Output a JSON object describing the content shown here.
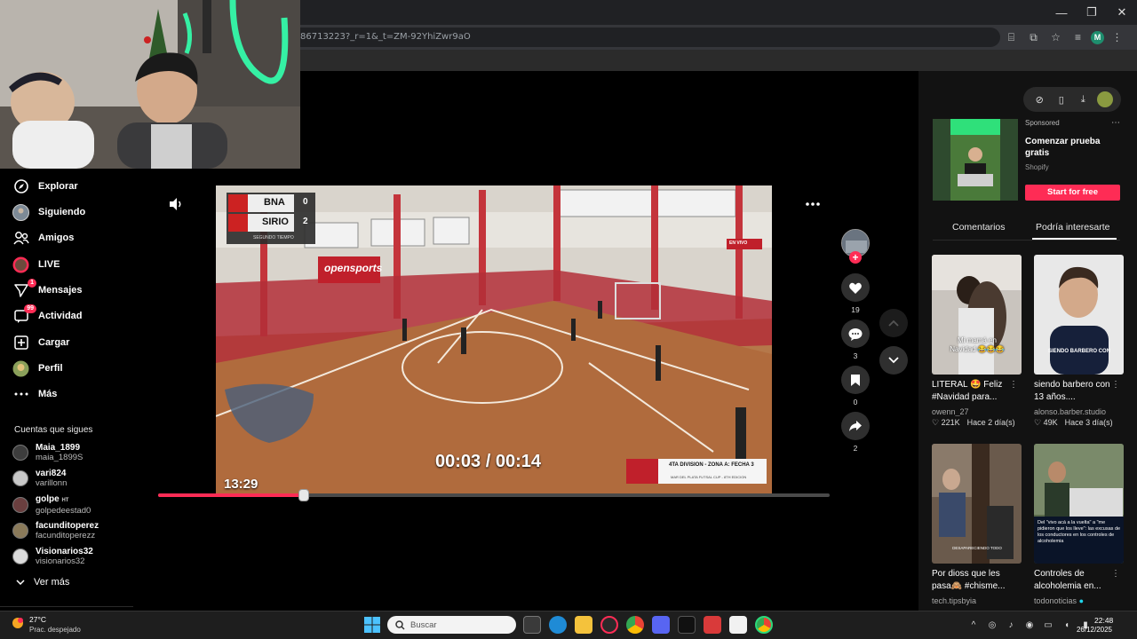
{
  "browser": {
    "url_fragment": "86713223?_r=1&_t=ZM-92YhiZwr9aO",
    "window_controls": [
      "—",
      "❐",
      "✕"
    ],
    "profile_initial": "M"
  },
  "sidebar": {
    "items": [
      {
        "label": "Explorar",
        "icon": "compass-icon"
      },
      {
        "label": "Siguiendo",
        "icon": "following-avatar-icon"
      },
      {
        "label": "Amigos",
        "icon": "friends-icon"
      },
      {
        "label": "LIVE",
        "icon": "live-icon"
      },
      {
        "label": "Mensajes",
        "icon": "messages-icon",
        "badge": "1"
      },
      {
        "label": "Actividad",
        "icon": "activity-icon",
        "badge": "99"
      },
      {
        "label": "Cargar",
        "icon": "upload-icon"
      },
      {
        "label": "Perfil",
        "icon": "profile-icon"
      },
      {
        "label": "Más",
        "icon": "more-icon"
      }
    ],
    "following_heading": "Cuentas que sigues",
    "accounts": [
      {
        "name": "Maia_1899",
        "handle": "maia_1899S"
      },
      {
        "name": "vari824",
        "handle": "varillonn"
      },
      {
        "name": "golpe",
        "name_suffix": "HT",
        "handle": "golpedeestad0"
      },
      {
        "name": "facunditoperez",
        "handle": "facunditoperezz"
      },
      {
        "name": "Visionarios32",
        "handle": "visionarios32"
      }
    ],
    "see_more": "Ver más"
  },
  "player": {
    "time_display": "00:03 / 00:14",
    "elapsed_overlay": "13:29",
    "progress_fraction": 0.216,
    "scoreboard": {
      "team1": "BNA",
      "score1": "0",
      "team2": "SIRIO",
      "score2": "2",
      "period": "SEGUNDO TIEMPO"
    },
    "live_tag": "EN VIVO",
    "lower_third": "4TA DIVISION - ZONA A: FECHA 3",
    "lower_third_sub": "MAR DEL PLATA FUTSAL CUP - 8TH EDICION",
    "banner_text": "opensports"
  },
  "actions": {
    "likes": "19",
    "comments": "3",
    "saves": "0",
    "shares": "2"
  },
  "ad": {
    "sponsored": "Sponsored",
    "title": "Comenzar prueba gratis",
    "brand": "Shopify",
    "cta": "Start for free"
  },
  "panel_tabs": {
    "comments": "Comentarios",
    "suggested": "Podría interesarte"
  },
  "cards": [
    {
      "desc": "LITERAL 🤩 Feliz #Navidad para...",
      "author": "owenn_27",
      "likes": "221K",
      "age": "Hace 2 día(s)",
      "overlay": "Mi mamá en Navidad 😂😂😂"
    },
    {
      "desc": "siendo barbero con 13 años....",
      "author": "alonso.barber.studio",
      "likes": "49K",
      "age": "Hace 3 día(s)",
      "overlay": "SIENDO BARBERO CON"
    },
    {
      "desc": "Por dioss que les pasa🙈 #chisme...",
      "author": "tech.tipsbyia",
      "likes": "",
      "age": "",
      "overlay": "DESAPARECIENDO TODO"
    },
    {
      "desc": "Controles de alcoholemia en...",
      "author": "todonoticias",
      "likes": "",
      "age": "",
      "overlay": "Del \"vivo acá a la vuelta\" a \"me pidieron que los lleve\": las excusas de los conductores en los controles de alcoholemia"
    }
  ],
  "taskbar": {
    "temperature": "27°C",
    "weather": "Prac. despejado",
    "search_placeholder": "Buscar",
    "time": "22:48",
    "date": "26/12/2025"
  },
  "colors": {
    "accent": "#fe2c55",
    "background": "#000000",
    "panel": "#121212"
  }
}
